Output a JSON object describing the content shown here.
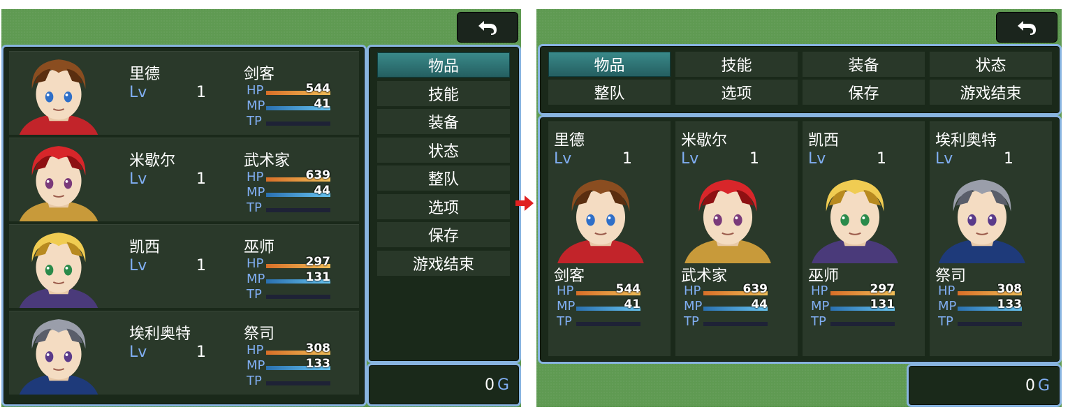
{
  "menu": {
    "commands": [
      "物品",
      "技能",
      "装备",
      "状态",
      "整队",
      "选项",
      "保存",
      "游戏结束"
    ],
    "selected": "物品"
  },
  "labels": {
    "lv": "Lv",
    "hp": "HP",
    "mp": "MP",
    "tp": "TP"
  },
  "actors": [
    {
      "name": "里德",
      "class": "剑客",
      "level": "1",
      "hp": "544",
      "mp": "41",
      "hp_ratio": 1,
      "mp_ratio": 1,
      "tp_ratio": 0,
      "portrait": {
        "hair": "#8a4d20",
        "hair_dark": "#5a2e10",
        "eyes": "#2f6fc8",
        "accent": "#c2242a",
        "name": "portrait-reid"
      }
    },
    {
      "name": "米歇尔",
      "class": "武术家",
      "level": "1",
      "hp": "639",
      "mp": "44",
      "hp_ratio": 1,
      "mp_ratio": 1,
      "tp_ratio": 0,
      "portrait": {
        "hair": "#d8262a",
        "hair_dark": "#8e1012",
        "eyes": "#7a3a7a",
        "accent": "#c89a3a",
        "name": "portrait-michelle"
      }
    },
    {
      "name": "凯西",
      "class": "巫师",
      "level": "1",
      "hp": "297",
      "mp": "131",
      "hp_ratio": 1,
      "mp_ratio": 1,
      "tp_ratio": 0,
      "portrait": {
        "hair": "#f0cc52",
        "hair_dark": "#b88a20",
        "eyes": "#2a8a4a",
        "accent": "#4a3a7a",
        "name": "portrait-casey"
      }
    },
    {
      "name": "埃利奥特",
      "class": "祭司",
      "level": "1",
      "hp": "308",
      "mp": "133",
      "hp_ratio": 1,
      "mp_ratio": 1,
      "tp_ratio": 0,
      "portrait": {
        "hair": "#9a9eaa",
        "hair_dark": "#5a5e6a",
        "eyes": "#5a3a8a",
        "accent": "#1e3a7a",
        "name": "portrait-elliot"
      }
    }
  ],
  "gold": {
    "value": "0",
    "unit": "G"
  },
  "colors": {
    "background": "#5f9a52",
    "window_border": "#88b4e0",
    "selected_command": "#2f7a7c",
    "arrow": "#e02020"
  },
  "icons": {
    "back": "return-arrow-icon",
    "transition": "right-arrow-icon"
  }
}
